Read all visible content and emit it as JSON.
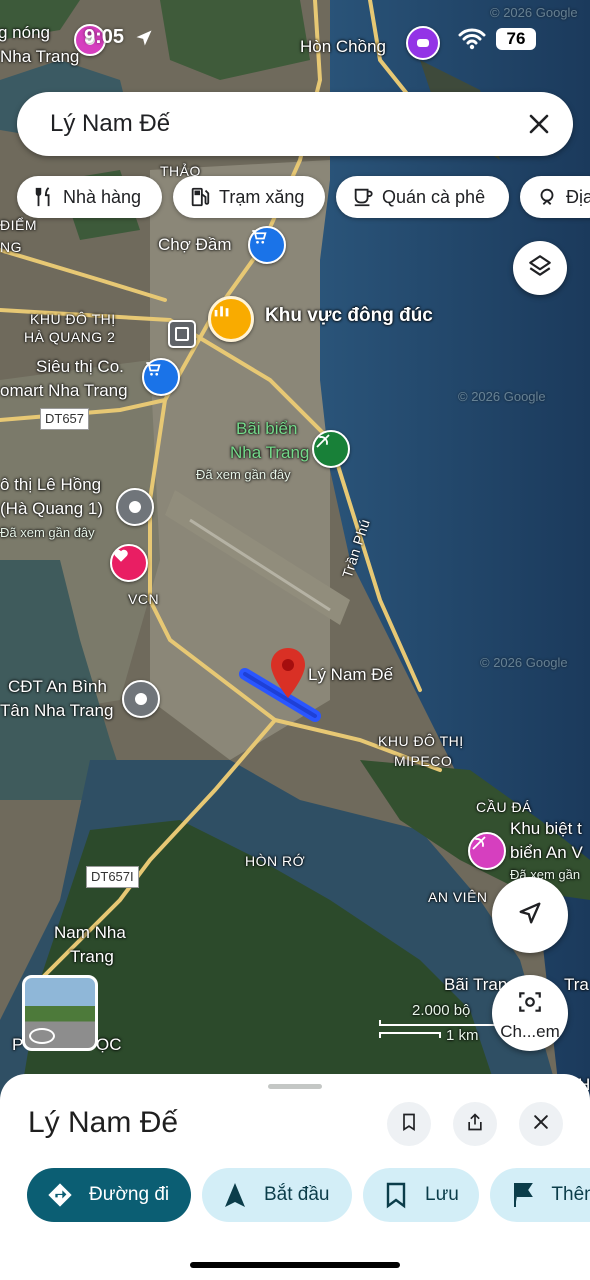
{
  "status_bar": {
    "time": "9:05",
    "battery": "76"
  },
  "search": {
    "query": "Lý Nam Đế"
  },
  "chips": [
    {
      "label": "Nhà hàng",
      "icon": "fork-knife-icon"
    },
    {
      "label": "Trạm xăng",
      "icon": "gas-station-icon"
    },
    {
      "label": "Quán cà phê",
      "icon": "coffee-cup-icon"
    },
    {
      "label": "Địa",
      "icon": "attraction-icon"
    }
  ],
  "map": {
    "labels": {
      "nong": "g nóng",
      "nha_trang_top": "Nha Trang",
      "hon_chong": "Hòn Chồng",
      "thao": "THẢO",
      "diem": "ĐIỂM",
      "ng": "NG",
      "cho_dam": "Chợ Đầm",
      "khu_vuc": "Khu vực đông đúc",
      "khu_do_thi_ha_quang_1": "KHU ĐÔ THỊ",
      "khu_do_thi_ha_quang_2": "HÀ QUANG 2",
      "sieu_thi_1": "Siêu thị Co.",
      "sieu_thi_2": "omart Nha Trang",
      "dt657": "DT657",
      "bai_bien_1": "Bãi biển",
      "bai_bien_2": "Nha Trang",
      "da_xem_1": "Đã xem gần đây",
      "le_hong_1": "ô thị Lê Hồng",
      "le_hong_2": "(Hà Quang 1)",
      "da_xem_2": "Đã xem gần đây",
      "vcn": "VCN",
      "tran_phu": "Trần Phú",
      "ly_nam_de": "Lý Nam Đế",
      "an_binh_1": "CĐT An Bình",
      "an_binh_2": "Tân Nha Trang",
      "mipeco_1": "KHU ĐÔ THỊ",
      "mipeco_2": "MIPECO",
      "cau_da": "CẦU ĐÁ",
      "khu_biet_1": "Khu biệt t",
      "khu_biet_2": "biển An V",
      "khu_biet_3": "Đã xem gần",
      "hon_ro": "HÒN RỚ",
      "an_vien": "AN VIÊN",
      "dt657i": "DT657I",
      "nam_nha_trang_1": "Nam Nha",
      "nam_nha_trang_2": "Trang",
      "bai_tran": "Bãi Tran",
      "tra": "Tra",
      "phuoc": "P",
      "oc": "ỌC",
      "h": "H",
      "copyright1": "© 2026 Google",
      "copyright2": "© 2026 Google",
      "copyright3": "© 2026 Google"
    },
    "scale": {
      "imperial": "2.000 bộ",
      "metric": "1 km"
    },
    "screenshot_fab_label": "Ch...em"
  },
  "sheet": {
    "title": "Lý Nam Đế",
    "actions": [
      {
        "label": "Đường đi",
        "icon": "directions-icon"
      },
      {
        "label": "Bắt đầu",
        "icon": "navigation-arrow-icon"
      },
      {
        "label": "Lưu",
        "icon": "bookmark-icon"
      },
      {
        "label": "Thêm",
        "icon": "flag-icon"
      }
    ]
  },
  "colors": {
    "accent_dark": "#0b5e73",
    "action_bg": "#d3eef7",
    "pin_red": "#d93025",
    "route_blue": "#2a56ff",
    "water": "#1e3f63"
  }
}
